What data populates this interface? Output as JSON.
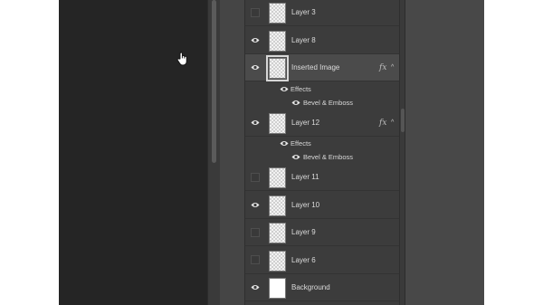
{
  "layers_panel": {
    "rows": [
      {
        "kind": "layer",
        "name": "Layer 3",
        "visible": false,
        "thumbnail": "checker"
      },
      {
        "kind": "layer",
        "name": "Layer 8",
        "visible": true,
        "thumbnail": "checker"
      },
      {
        "kind": "layer",
        "name": "Inserted Image",
        "visible": true,
        "thumbnail": "checker",
        "selected": true,
        "fx": "fx",
        "caret": "^"
      },
      {
        "kind": "effects",
        "label": "Effects",
        "visible": true
      },
      {
        "kind": "effect-item",
        "label": "Bevel & Emboss",
        "visible": true
      },
      {
        "kind": "layer",
        "name": "Layer 12",
        "visible": true,
        "thumbnail": "checker",
        "fx": "fx",
        "caret": "^"
      },
      {
        "kind": "effects",
        "label": "Effects",
        "visible": true
      },
      {
        "kind": "effect-item",
        "label": "Bevel & Emboss",
        "visible": true
      },
      {
        "kind": "layer",
        "name": "Layer 11",
        "visible": false,
        "thumbnail": "checker"
      },
      {
        "kind": "layer",
        "name": "Layer 10",
        "visible": true,
        "thumbnail": "checker"
      },
      {
        "kind": "layer",
        "name": "Layer 9",
        "visible": false,
        "thumbnail": "checker"
      },
      {
        "kind": "layer",
        "name": "Layer 6",
        "visible": false,
        "thumbnail": "checker"
      },
      {
        "kind": "layer",
        "name": "Background",
        "visible": true,
        "thumbnail": "white"
      }
    ]
  },
  "icons": {
    "visibility": "eye-icon",
    "effects_badge": "fx-icon",
    "collapse": "chevron-up-icon",
    "pointer": "hand-cursor-icon"
  },
  "colors": {
    "panel_bg": "#3c3c3c",
    "selected_row": "#4b4b4b",
    "canvas_bg": "#252525",
    "text": "#dcdcdc"
  }
}
